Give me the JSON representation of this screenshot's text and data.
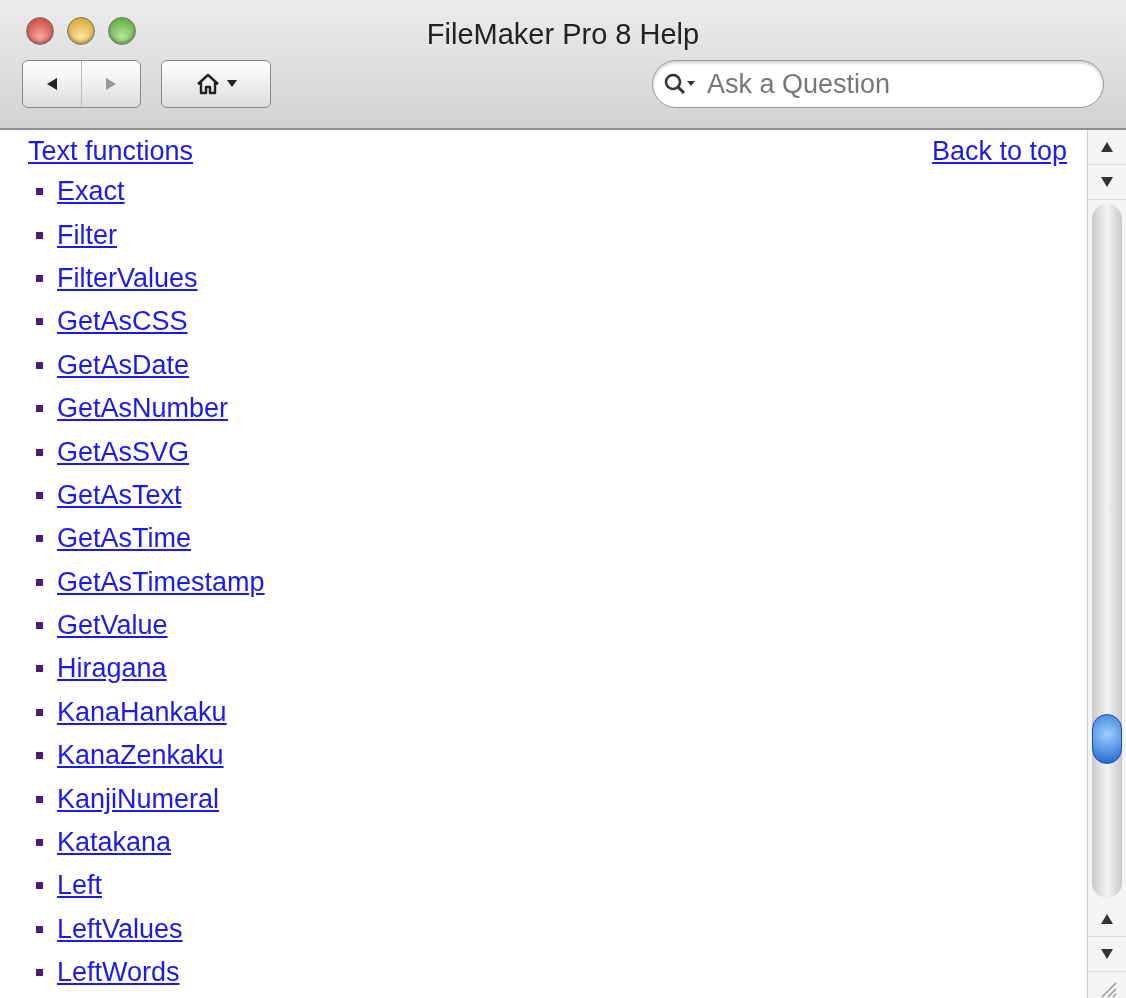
{
  "window": {
    "title": "FileMaker Pro 8 Help"
  },
  "search": {
    "placeholder": "Ask a Question"
  },
  "page": {
    "heading": "Text functions",
    "back_link": "Back to top",
    "links": [
      "Exact",
      "Filter",
      "FilterValues",
      "GetAsCSS",
      "GetAsDate",
      "GetAsNumber",
      "GetAsSVG",
      "GetAsText",
      "GetAsTime",
      "GetAsTimestamp",
      "GetValue",
      "Hiragana",
      "KanaHankaku",
      "KanaZenkaku",
      "KanjiNumeral",
      "Katakana",
      "Left",
      "LeftValues",
      "LeftWords"
    ]
  }
}
